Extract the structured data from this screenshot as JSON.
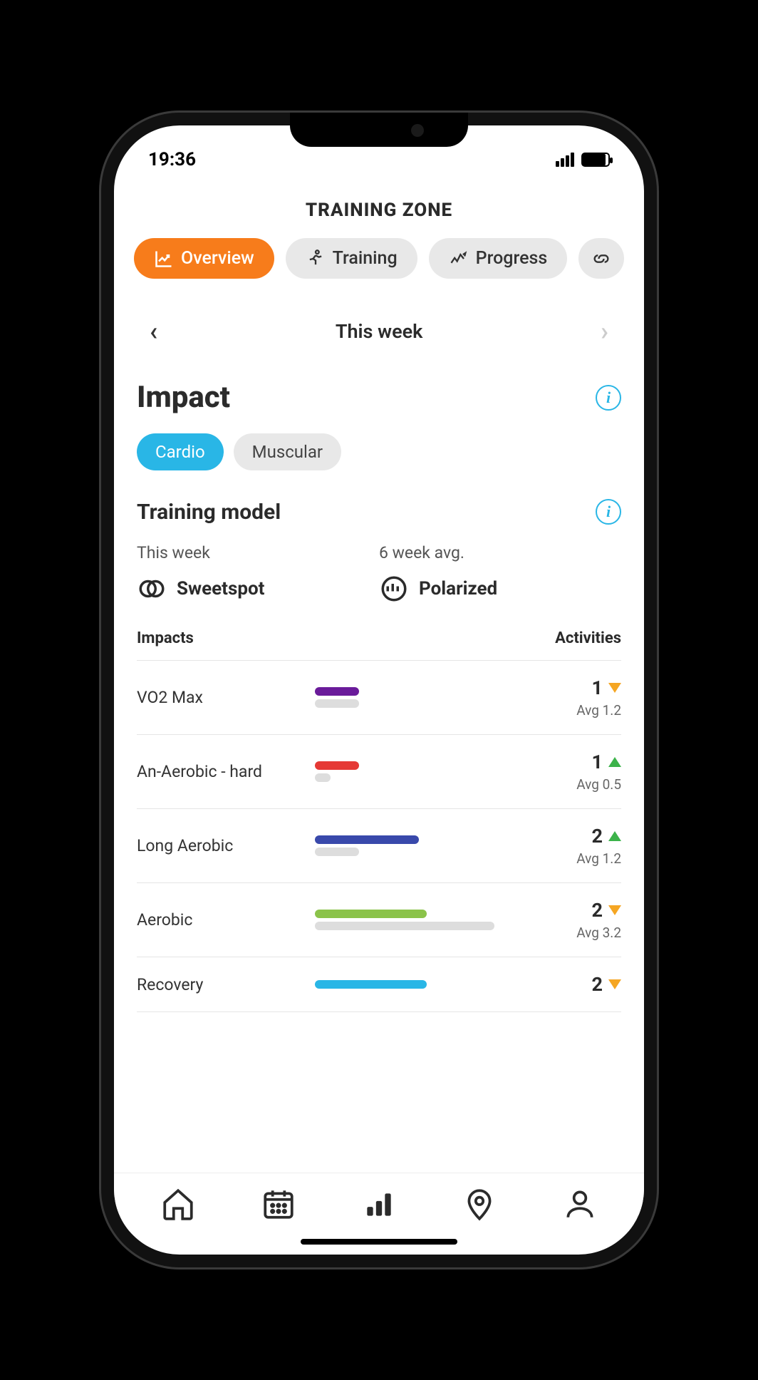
{
  "status": {
    "time": "19:36"
  },
  "header": {
    "title": "TRAINING ZONE"
  },
  "tabs": [
    {
      "label": "Overview",
      "icon": "chart-up-icon",
      "active": true
    },
    {
      "label": "Training",
      "icon": "runner-icon",
      "active": false
    },
    {
      "label": "Progress",
      "icon": "trend-icon",
      "active": false
    },
    {
      "label": "",
      "icon": "link-icon",
      "active": false
    }
  ],
  "week_nav": {
    "label": "This week",
    "prev_enabled": true,
    "next_enabled": false
  },
  "impact": {
    "title": "Impact",
    "sub_tabs": [
      {
        "label": "Cardio",
        "active": true
      },
      {
        "label": "Muscular",
        "active": false
      }
    ]
  },
  "training_model": {
    "title": "Training model",
    "cols": [
      {
        "label": "This week",
        "value": "Sweetspot",
        "icon": "sweetspot-icon"
      },
      {
        "label": "6 week avg.",
        "value": "Polarized",
        "icon": "polarized-icon"
      }
    ]
  },
  "impacts_table": {
    "head_left": "Impacts",
    "head_right": "Activities",
    "rows": [
      {
        "name": "VO2 Max",
        "color": "#6a1b9a",
        "value_pct": 22,
        "avg_pct": 22,
        "count": 1,
        "trend": "down",
        "avg_label": "Avg 1.2"
      },
      {
        "name": "An-Aerobic - hard",
        "color": "#e53935",
        "value_pct": 22,
        "avg_pct": 8,
        "count": 1,
        "trend": "up",
        "avg_label": "Avg 0.5"
      },
      {
        "name": "Long Aerobic",
        "color": "#3949ab",
        "value_pct": 52,
        "avg_pct": 22,
        "count": 2,
        "trend": "up",
        "avg_label": "Avg 1.2"
      },
      {
        "name": "Aerobic",
        "color": "#8bc34a",
        "value_pct": 56,
        "avg_pct": 90,
        "count": 2,
        "trend": "down",
        "avg_label": "Avg 3.2"
      },
      {
        "name": "Recovery",
        "color": "#29b6e6",
        "value_pct": 56,
        "avg_pct": 0,
        "count": 2,
        "trend": "down",
        "avg_label": ""
      }
    ]
  },
  "bottom_nav": [
    {
      "icon": "home-icon"
    },
    {
      "icon": "calendar-icon"
    },
    {
      "icon": "bar-chart-icon"
    },
    {
      "icon": "location-icon"
    },
    {
      "icon": "profile-icon"
    }
  ],
  "colors": {
    "accent": "#f77c1b",
    "accent2": "#29b6e6"
  }
}
